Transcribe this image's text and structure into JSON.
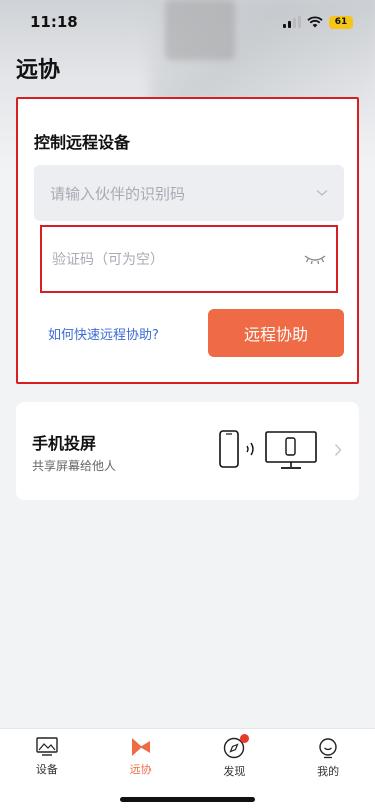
{
  "status_bar": {
    "time": "11:18",
    "battery": "61"
  },
  "page": {
    "title": "远协"
  },
  "remote_control": {
    "title": "控制远程设备",
    "partner_id_placeholder": "请输入伙伴的识别码",
    "verify_code_placeholder": "验证码（可为空）",
    "help_link": "如何快速远程协助?",
    "assist_button": "远程协助"
  },
  "screen_mirror": {
    "title": "手机投屏",
    "subtitle": "共享屏幕给他人"
  },
  "tabs": [
    {
      "label": "设备",
      "icon": "device-icon",
      "active": false
    },
    {
      "label": "远协",
      "icon": "remote-assist-icon",
      "active": true
    },
    {
      "label": "发现",
      "icon": "compass-icon",
      "active": false,
      "badge": true
    },
    {
      "label": "我的",
      "icon": "profile-icon",
      "active": false
    }
  ],
  "colors": {
    "accent": "#ee6b45",
    "link": "#3d6bd6",
    "highlight_border": "#d81e1e",
    "badge": "#e63a2a"
  }
}
